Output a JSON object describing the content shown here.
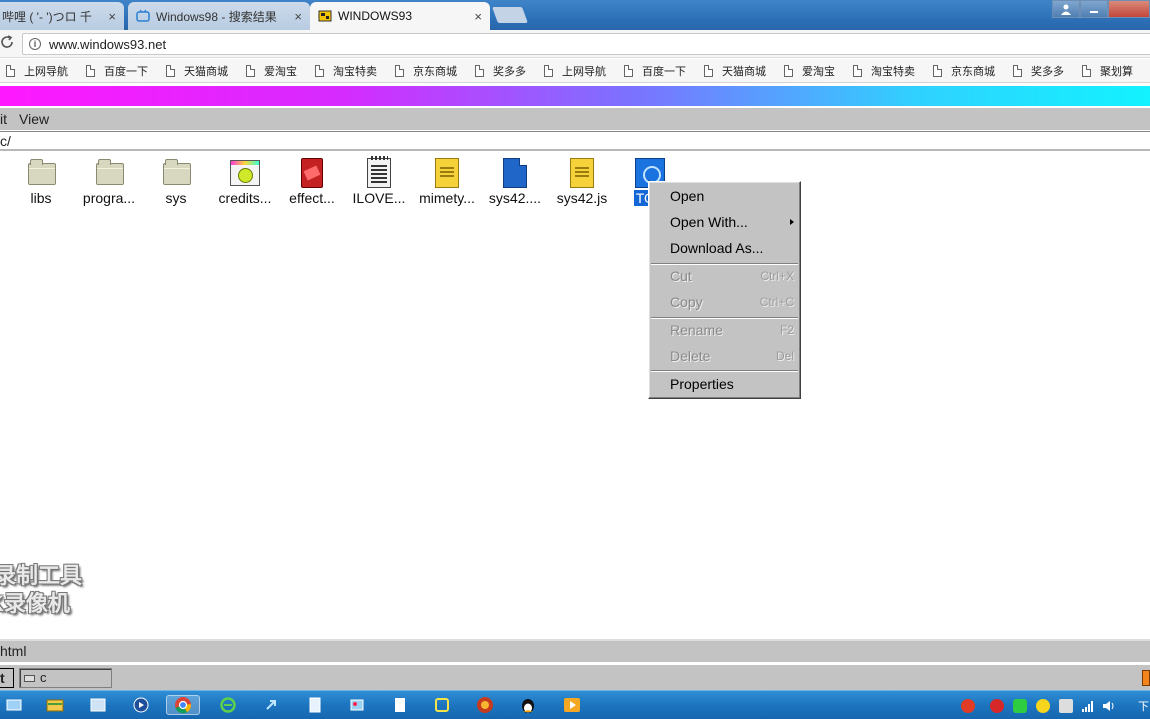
{
  "browser": {
    "tabs": [
      {
        "title": "哔哩 ( '- ')つロ 千",
        "active": false
      },
      {
        "title": "Windows98 - 搜索结果",
        "active": false
      },
      {
        "title": "WINDOWS93",
        "active": true
      }
    ],
    "tab_close_glyph": "×",
    "url": "www.windows93.net",
    "bookmarks": [
      "上网导航",
      "百度一下",
      "天猫商城",
      "爱淘宝",
      "淘宝特卖",
      "京东商城",
      "奖多多",
      "上网导航",
      "百度一下",
      "天猫商城",
      "爱淘宝",
      "淘宝特卖",
      "京东商城",
      "奖多多",
      "聚划算"
    ]
  },
  "explorer": {
    "menu": [
      "it",
      "View"
    ],
    "path": "c/",
    "files": [
      {
        "name": "libs",
        "icon": "folder-icon"
      },
      {
        "name": "progra...",
        "icon": "folder-icon"
      },
      {
        "name": "sys",
        "icon": "folder-icon"
      },
      {
        "name": "credits...",
        "icon": "credits-icon"
      },
      {
        "name": "effect...",
        "icon": "effect-icon"
      },
      {
        "name": "ILOVE...",
        "icon": "text-file-icon"
      },
      {
        "name": "mimety...",
        "icon": "js-file-icon"
      },
      {
        "name": "sys42....",
        "icon": "blue-file-icon"
      },
      {
        "name": "sys42.js",
        "icon": "js-file-icon"
      },
      {
        "name": "TOS",
        "icon": "tos-icon",
        "selected": true
      }
    ],
    "context_menu": {
      "open": "Open",
      "open_with": "Open With...",
      "download_as": "Download As...",
      "cut": "Cut",
      "cut_shortcut": "Ctrl+X",
      "copy": "Copy",
      "copy_shortcut": "Ctrl+C",
      "rename": "Rename",
      "rename_shortcut": "F2",
      "delete": "Delete",
      "delete_shortcut": "Del",
      "properties": "Properties"
    },
    "status": "html"
  },
  "watermark": {
    "line1": "录制工具",
    "line2": "K录像机"
  },
  "w93_taskbar": {
    "start": "t",
    "task_label": "c"
  },
  "win_taskbar": {
    "clock": "下"
  },
  "colors": {
    "selection": "#1468d6",
    "window_gray": "#c3c3c3"
  }
}
